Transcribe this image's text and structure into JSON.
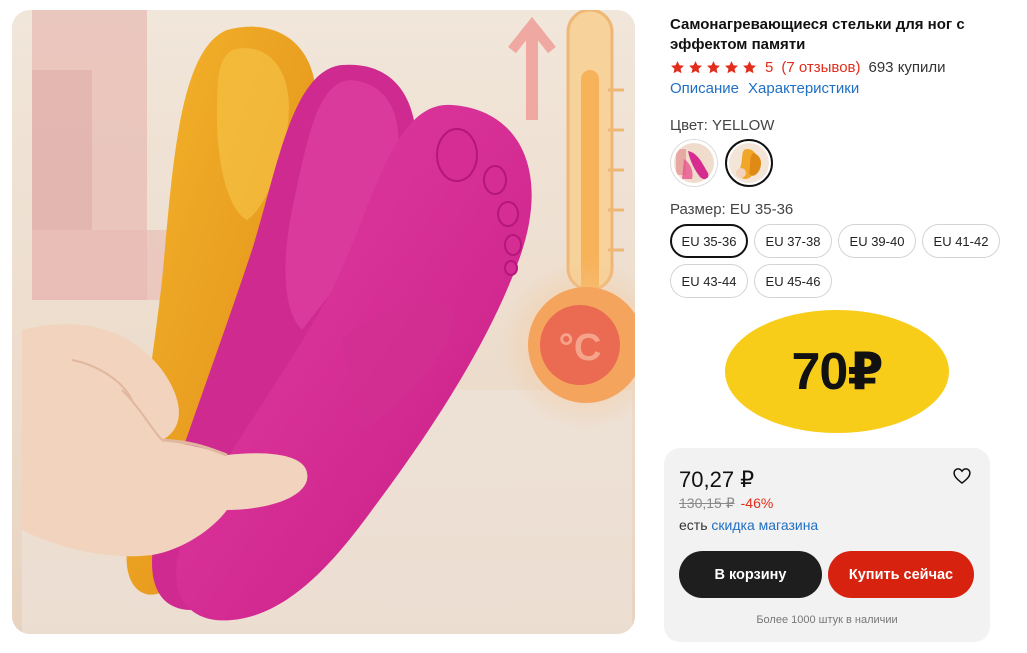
{
  "product": {
    "title": "Самонагревающиеся стельки для ног с эффектом памяти",
    "rating_value": "5",
    "reviews_link": "(7 отзывов)",
    "bought": "693 купили",
    "image_alt_icon": "product-photo-insoles"
  },
  "tabs": [
    "Описание",
    "Характеристики"
  ],
  "color": {
    "label": "Цвет: YELLOW",
    "selected": "YELLOW"
  },
  "size": {
    "label": "Размер: EU 35-36",
    "options": [
      "EU 35-36",
      "EU 37-38",
      "EU 39-40",
      "EU 41-42",
      "EU 43-44",
      "EU 45-46"
    ],
    "selected_index": 0
  },
  "promo": {
    "text": "70₽",
    "color": "#f7cd1a"
  },
  "price": {
    "current": "70,27 ₽",
    "old": "130,15 ₽",
    "discount": "-46%",
    "store_prefix": "есть",
    "store_link": "скидка магазина",
    "add_to_cart": "В корзину",
    "buy_now": "Купить сейчас",
    "stock": "Более 1000 штук в наличии"
  },
  "colors": {
    "accent_red": "#e12e1c",
    "link_blue": "#1f6fc4",
    "button_dark": "#1e1e1e",
    "button_red": "#d6220f"
  }
}
